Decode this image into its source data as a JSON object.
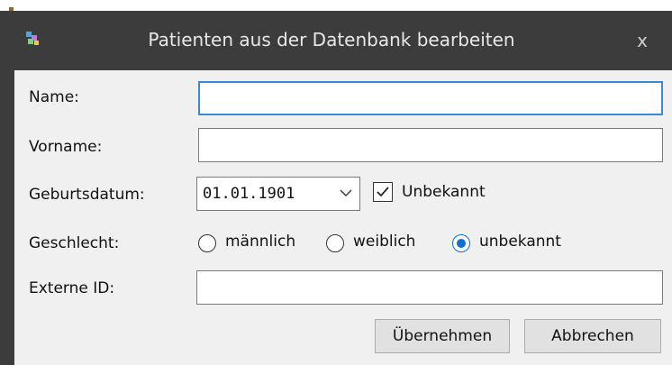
{
  "window": {
    "title": "Patienten aus der Datenbank bearbeiten",
    "close_glyph": "x"
  },
  "form": {
    "name_label": "Name:",
    "name_value": "",
    "vorname_label": "Vorname:",
    "vorname_value": "",
    "geburtsdatum_label": "Geburtsdatum:",
    "geburtsdatum_value": "01.01.1901",
    "unbekannt_checkbox_label": "Unbekannt",
    "unbekannt_checked": true,
    "geschlecht_label": "Geschlecht:",
    "gender_options": [
      "männlich",
      "weiblich",
      "unbekannt"
    ],
    "gender_selected": "unbekannt",
    "externe_id_label": "Externe ID:",
    "externe_id_value": ""
  },
  "buttons": {
    "apply_label": "Übernehmen",
    "cancel_label": "Abbrechen"
  },
  "colors": {
    "titlebar": "#3c3c3c",
    "client": "#f0f0f0",
    "focus_accent": "#3a8ad8",
    "radio_accent": "#0b6fd6"
  },
  "icons": {
    "app": "app-icon",
    "close": "close-icon",
    "dropdown": "chevron-down-icon",
    "checkmark": "checkmark-icon"
  }
}
